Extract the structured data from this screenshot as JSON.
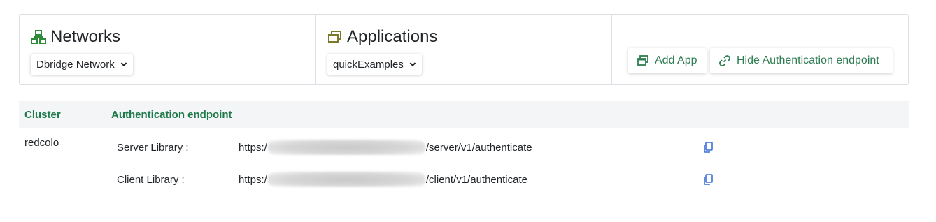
{
  "networks": {
    "title": "Networks",
    "selected": "Dbridge Network"
  },
  "applications": {
    "title": "Applications",
    "selected": "quickExamples"
  },
  "actions": {
    "add_app": "Add App",
    "hide_auth": "Hide Authentication endpoint"
  },
  "table": {
    "headers": [
      "Cluster",
      "Authentication endpoint"
    ],
    "cluster": "redcolo",
    "rows": [
      {
        "label": "Server Library :",
        "url_prefix": "https:/",
        "url_suffix": "/server/v1/authenticate"
      },
      {
        "label": "Client Library :",
        "url_prefix": "https:/",
        "url_suffix": "/client/v1/authenticate"
      }
    ]
  },
  "colors": {
    "accent_green": "#2e7d52",
    "header_green": "#1e7a4a",
    "icon_olive": "#7a7a2a",
    "copy_blue": "#3a6fd8"
  }
}
